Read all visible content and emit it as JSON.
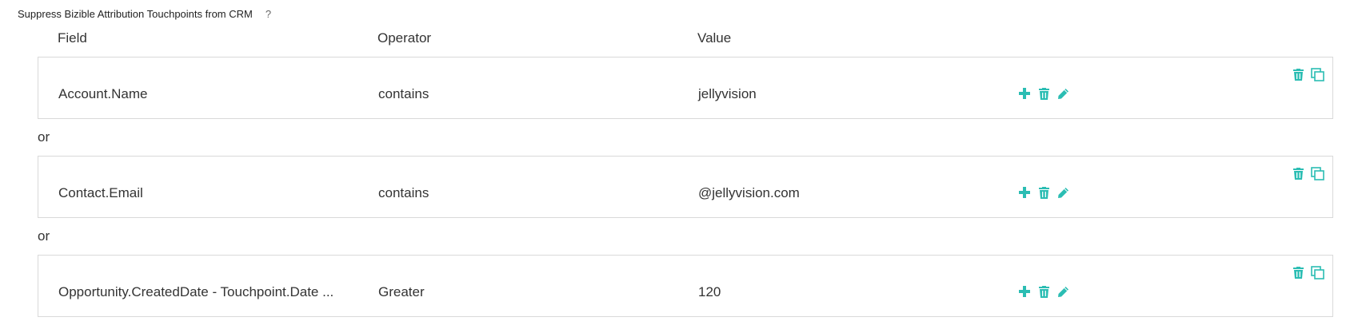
{
  "title": "Suppress Bizible Attribution Touchpoints from CRM",
  "help_label": "?",
  "headers": {
    "field": "Field",
    "operator": "Operator",
    "value": "Value"
  },
  "rules": [
    {
      "field": "Account.Name",
      "operator": "contains",
      "value": "jellyvision"
    },
    {
      "field": "Contact.Email",
      "operator": "contains",
      "value": "@jellyvision.com"
    },
    {
      "field": "Opportunity.CreatedDate - Touchpoint.Date ...",
      "operator": "Greater",
      "value": "120"
    }
  ],
  "connectors": [
    "or",
    "or"
  ],
  "icons": {
    "add": "plus-icon",
    "delete": "trash-icon",
    "edit": "pencil-icon",
    "copy": "copy-icon",
    "color": "#2bbdb3"
  }
}
